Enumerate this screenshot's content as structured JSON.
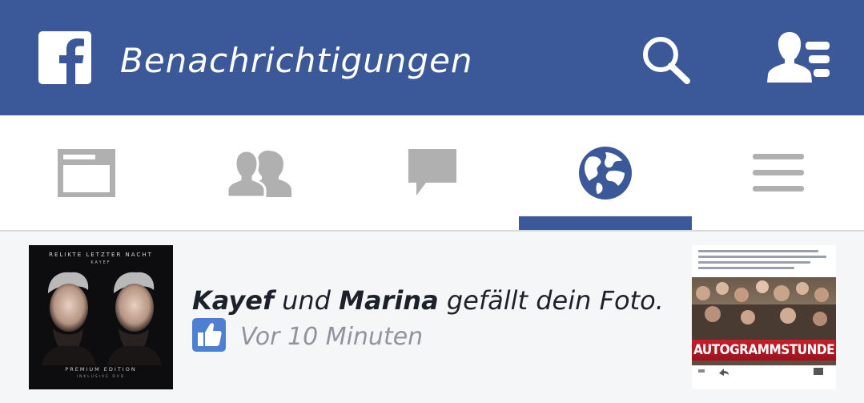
{
  "header": {
    "title": "Benachrichtigungen",
    "background": "#3b5998",
    "logo_icon": "facebook-logo",
    "search_icon": "search-icon",
    "friend_requests_icon": "friend-requests-icon"
  },
  "tabs": [
    {
      "name": "news-feed",
      "icon": "news-feed-icon",
      "active": false
    },
    {
      "name": "friends",
      "icon": "friends-icon",
      "active": false
    },
    {
      "name": "messages",
      "icon": "chat-bubble-icon",
      "active": false
    },
    {
      "name": "notifications",
      "icon": "globe-icon",
      "active": true
    },
    {
      "name": "more",
      "icon": "menu-icon",
      "active": false
    }
  ],
  "notification": {
    "actor1": "Kayef",
    "joiner": "und",
    "actor2": "Marina",
    "action": "gefällt dein Foto.",
    "time": "Vor 10 Minuten",
    "badge_icon": "like-thumb-icon",
    "album": {
      "title": "RELIKTE LETZTER NACHT",
      "artist": "KAYEF",
      "edition": "PREMIUM EDITION",
      "edition_sub": "INKLUSIVE DVD"
    },
    "post_banner": "AUTOGRAMMSTUNDE"
  },
  "colors": {
    "brand": "#3b5998",
    "tab_icon": "#b0b0b0",
    "active_tab": "#3b5998",
    "like_badge": "#4e7fd1"
  }
}
